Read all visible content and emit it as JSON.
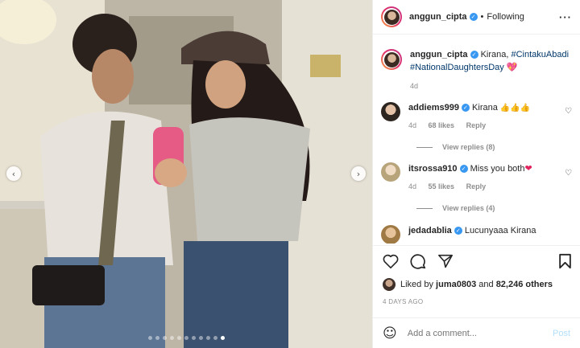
{
  "post": {
    "username": "anggun_cipta",
    "follow_state": "Following",
    "more_icon": "more-options-icon"
  },
  "caption": {
    "username": "anggun_cipta",
    "text": "Kirana,",
    "hashtag1": "#CintakuAbadi",
    "hashtag2": "#NationalDaughtersDay",
    "emoji": "💖",
    "time": "4d"
  },
  "comments": [
    {
      "username": "addiems999",
      "text": "Kirana",
      "emoji": "👍👍👍",
      "time": "4d",
      "likes": "68 likes",
      "reply": "Reply",
      "view_replies": "View replies (8)"
    },
    {
      "username": "itsrossa910",
      "text": "Miss you both",
      "emoji": "❤",
      "time": "4d",
      "likes": "55 likes",
      "reply": "Reply",
      "view_replies": "View replies (4)"
    },
    {
      "username": "jedadablia",
      "text": "Lucunyaaa Kirana"
    }
  ],
  "likes": {
    "prefix": "Liked by",
    "user": "juma0803",
    "conj": "and",
    "count": "82,246 others"
  },
  "time_ago": "4 DAYS AGO",
  "comment_input": {
    "placeholder": "Add a comment...",
    "post_label": "Post"
  },
  "carousel": {
    "total": 11,
    "active_index": 10
  },
  "colors": {
    "verified": "#3897f0",
    "link": "#00376b",
    "muted": "#8e8e8e",
    "post_disabled": "#b2dffc"
  }
}
